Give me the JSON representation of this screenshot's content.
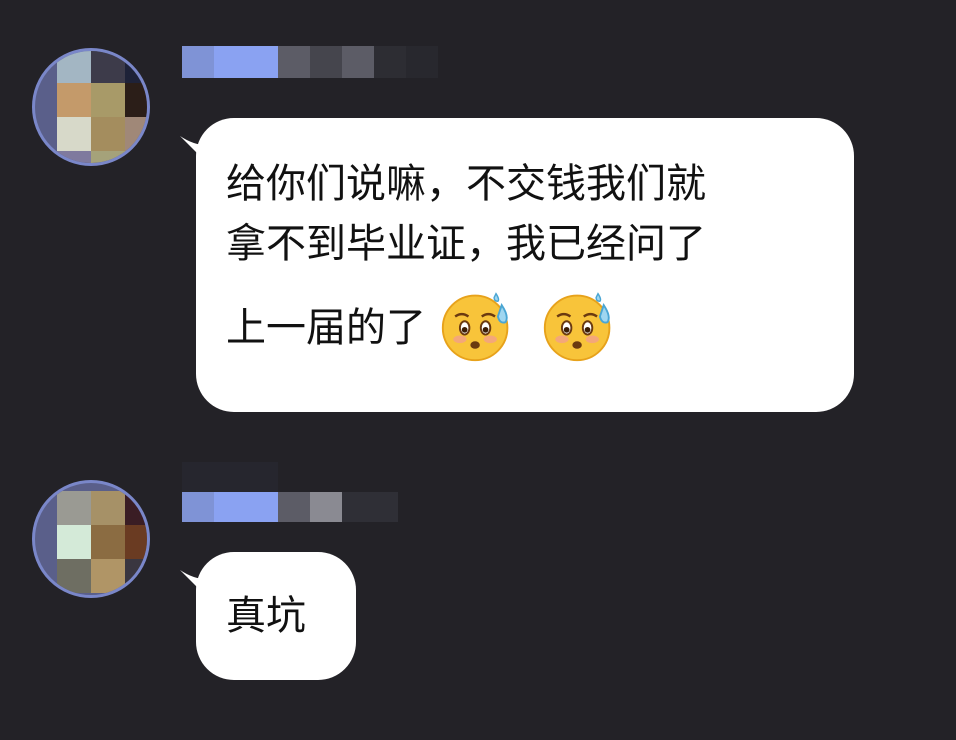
{
  "messages": [
    {
      "lines": [
        "给你们说嘛，不交钱我们就",
        "拿不到毕业证，我已经问了"
      ],
      "last_line": "上一届的了",
      "emojis": [
        "worried-sweat-face-emoji",
        "worried-sweat-face-emoji"
      ]
    },
    {
      "lines": [
        "真坑"
      ]
    }
  ],
  "colors": {
    "background": "#232227",
    "bubble": "#ffffff",
    "avatar_border": "#7a87c9",
    "name_blur": "#8aa0f0"
  }
}
